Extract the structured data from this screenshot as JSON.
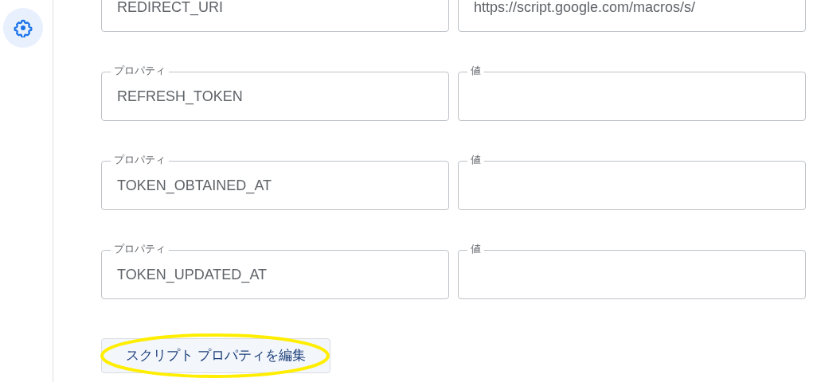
{
  "sidebar": {
    "items": [
      {
        "kind": "settings",
        "selected": true
      }
    ]
  },
  "properties": [
    {
      "property": "REDIRECT_URI",
      "value": "https://script.google.com/macros/s/"
    },
    {
      "property_label": "プロパティ",
      "property": "REFRESH_TOKEN",
      "value_label": "値"
    },
    {
      "property_label": "プロパティ",
      "property": "TOKEN_OBTAINED_AT",
      "value_label": "値"
    },
    {
      "property_label": "プロパティ",
      "property": "TOKEN_UPDATED_AT",
      "value_label": "値"
    }
  ],
  "edit_button": {
    "label": "スクリプト プロパティを編集",
    "highlighted": true
  }
}
